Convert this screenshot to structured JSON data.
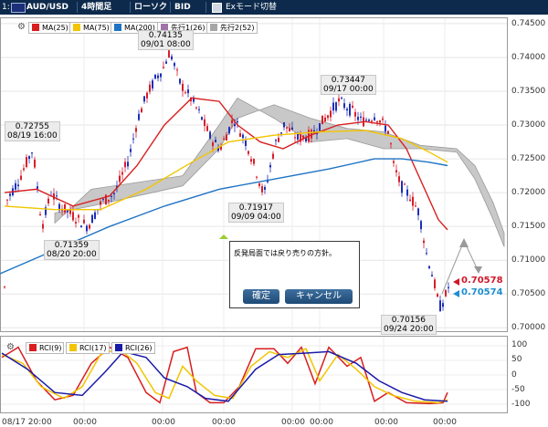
{
  "toolbar": {
    "id_marker": "1:",
    "symbol": "AUD/USD",
    "timeframe": "4時間足",
    "chart_type": "ローソク",
    "price_side": "BID",
    "mode_label": "Exモード切替"
  },
  "chart_data": {
    "type": "candlestick",
    "symbol": "AUD/USD",
    "yticks": [
      "0.74500",
      "0.74000",
      "0.73500",
      "0.73000",
      "0.72500",
      "0.72000",
      "0.71500",
      "0.71000",
      "0.70500",
      "0.70000"
    ],
    "ylim": [
      0.6995,
      0.7458
    ],
    "xticks": [
      "08/17 20:00",
      "00:00",
      "00:00",
      "00:00",
      "00:00",
      "00:00",
      "00:00",
      "00:00"
    ],
    "indicators": [
      {
        "name": "MA(25)",
        "color": "#d81e1e"
      },
      {
        "name": "MA(75)",
        "color": "#f2c500"
      },
      {
        "name": "MA(200)",
        "color": "#1f73c4"
      },
      {
        "name": "先行1(26)",
        "color": "#a072a8"
      },
      {
        "name": "先行2(52)",
        "color": "#a6a6a6"
      }
    ],
    "annotations": [
      {
        "price": "0.72755",
        "time": "08/19 16:00"
      },
      {
        "price": "0.71359",
        "time": "08/20 20:00"
      },
      {
        "price": "0.74135",
        "time": "09/01 08:00"
      },
      {
        "price": "0.71917",
        "time": "09/09 04:00"
      },
      {
        "price": "0.73447",
        "time": "09/17 00:00"
      },
      {
        "price": "0.70156",
        "time": "09/24 20:00"
      }
    ],
    "current_prices": [
      {
        "value": "0.70578",
        "color": "#d0172a"
      },
      {
        "value": "0.70574",
        "color": "#1d8ed0"
      }
    ],
    "rci": {
      "series": [
        {
          "name": "RCI(9)",
          "color": "#d81e1e"
        },
        {
          "name": "RCI(17)",
          "color": "#f2c500"
        },
        {
          "name": "RCI(26)",
          "color": "#1a1aa8"
        }
      ],
      "yticks": [
        "100",
        "50",
        "0",
        "-50",
        "-100"
      ],
      "ylim": [
        -100,
        100
      ]
    }
  },
  "dialog": {
    "message": "反発局面では戻り売りの方針。",
    "confirm_label": "確定",
    "cancel_label": "キャンセル"
  }
}
